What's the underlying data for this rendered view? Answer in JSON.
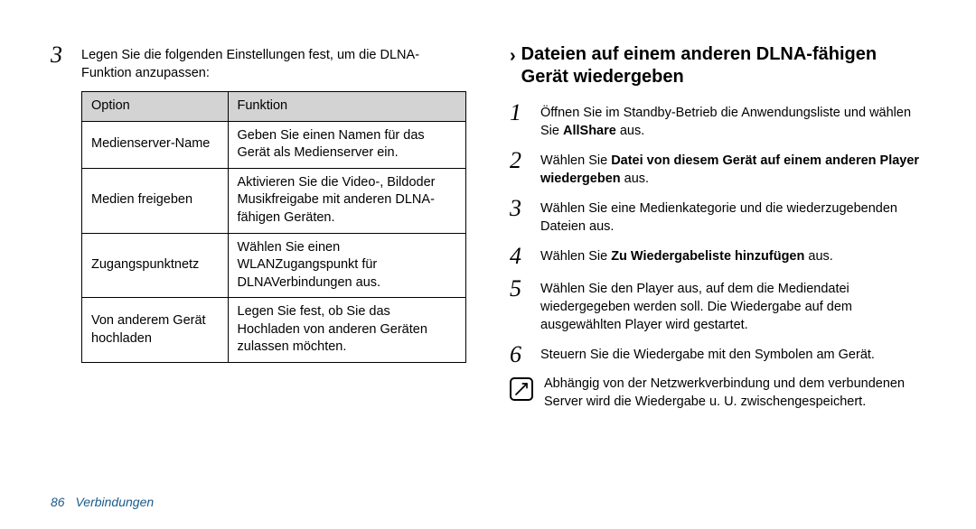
{
  "left": {
    "step3": {
      "num": "3",
      "text": "Legen Sie die folgenden Einstellungen fest, um die DLNA-Funktion anzupassen:"
    },
    "table": {
      "header": {
        "option": "Option",
        "function": "Funktion"
      },
      "rows": [
        {
          "option": "Medienserver-Name",
          "function": "Geben Sie einen Namen für das Gerät als Medienserver ein."
        },
        {
          "option": "Medien freigeben",
          "function": "Aktivieren Sie die Video-, Bildoder Musikfreigabe mit anderen DLNA-fähigen Geräten."
        },
        {
          "option": "Zugangspunktnetz",
          "function": "Wählen Sie einen WLANZugangspunkt für DLNAVerbindungen aus."
        },
        {
          "option": "Von anderem Gerät hochladen",
          "function": "Legen Sie fest, ob Sie das Hochladen von anderen Geräten zulassen möchten."
        }
      ]
    }
  },
  "right": {
    "heading": "Dateien auf einem anderen DLNA-fähigen Gerät wiedergeben",
    "steps": [
      {
        "num": "1",
        "pre": "Öffnen Sie im Standby-Betrieb die Anwendungsliste und wählen Sie ",
        "bold": "AllShare",
        "post": " aus."
      },
      {
        "num": "2",
        "pre": "Wählen Sie ",
        "bold": "Datei von diesem Gerät auf einem anderen Player wiedergeben",
        "post": " aus."
      },
      {
        "num": "3",
        "pre": "Wählen Sie eine Medienkategorie und die wiederzugebenden Dateien aus.",
        "bold": "",
        "post": ""
      },
      {
        "num": "4",
        "pre": "Wählen Sie ",
        "bold": "Zu Wiedergabeliste hinzufügen",
        "post": " aus."
      },
      {
        "num": "5",
        "pre": "Wählen Sie den Player aus, auf dem die Mediendatei wiedergegeben werden soll. Die Wiedergabe auf dem ausgewählten Player wird gestartet.",
        "bold": "",
        "post": ""
      },
      {
        "num": "6",
        "pre": "Steuern Sie die Wiedergabe mit den Symbolen am Gerät.",
        "bold": "",
        "post": ""
      }
    ],
    "note": "Abhängig von der Netzwerkverbindung und dem verbundenen Server wird die Wiedergabe u. U. zwischengespeichert."
  },
  "footer": {
    "page": "86",
    "section": "Verbindungen"
  }
}
